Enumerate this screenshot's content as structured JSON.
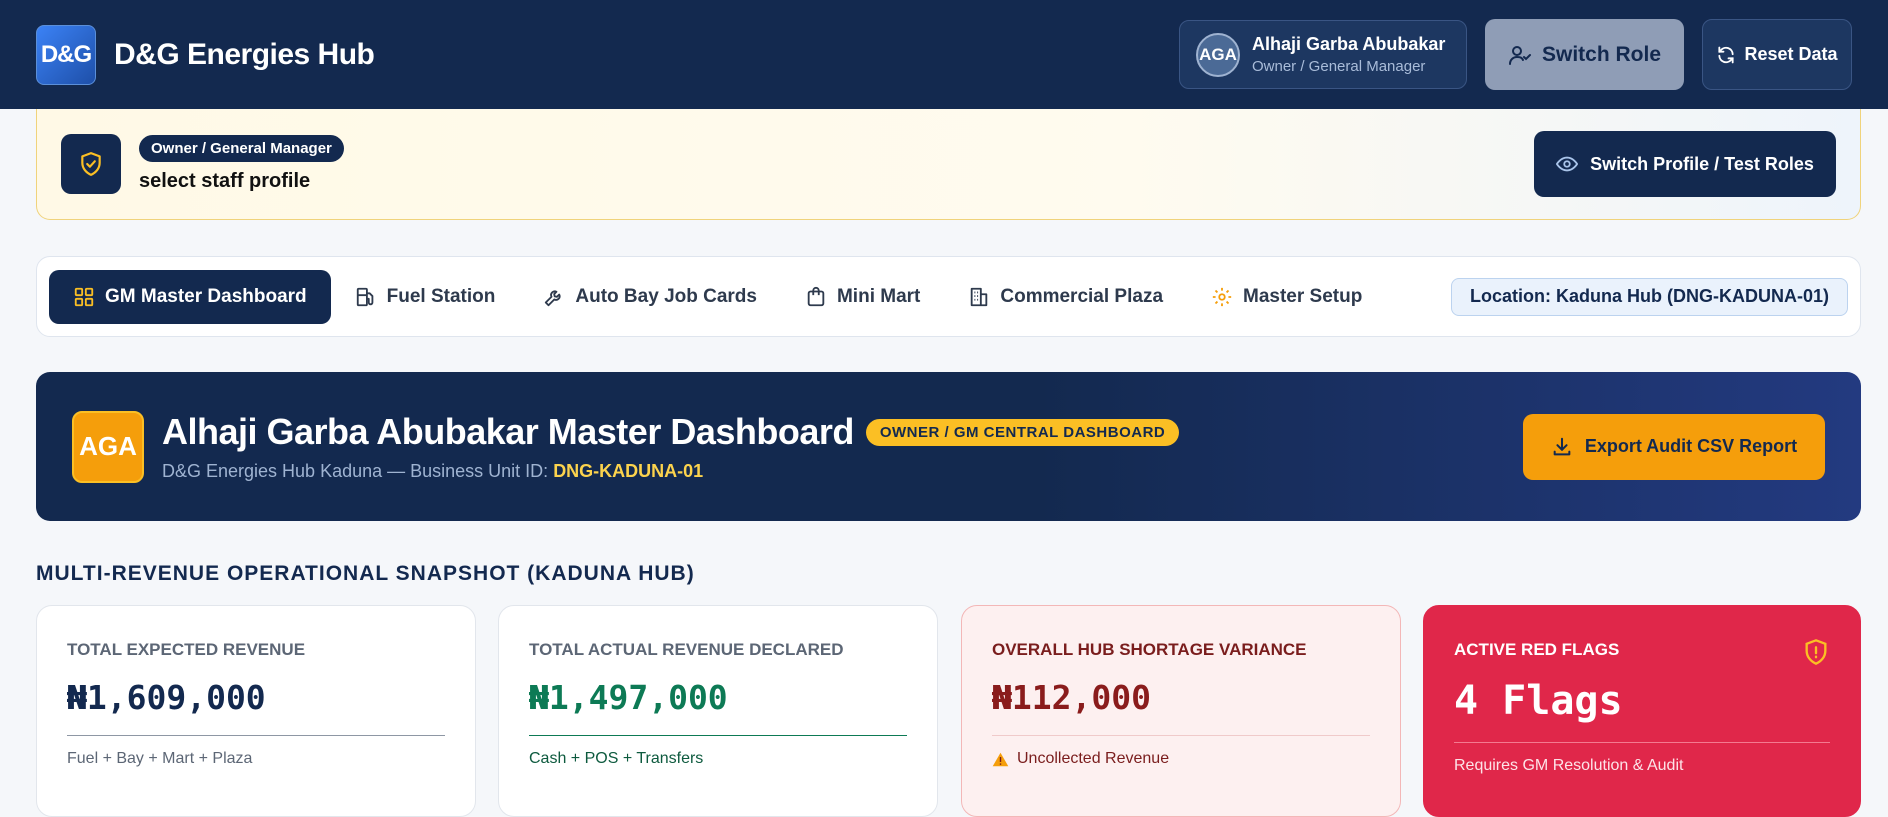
{
  "header": {
    "logo_text": "D&G",
    "app_title": "D&G Energies Hub",
    "user": {
      "initials": "AGA",
      "name": "Alhaji Garba Abubakar",
      "role": "Owner / General Manager"
    },
    "switch_role_label": "Switch Role",
    "reset_label": "Reset Data"
  },
  "role_banner": {
    "role_pill": "Owner / General Manager",
    "subtitle": "select staff profile",
    "profile_button": "Switch Profile / Test Roles"
  },
  "nav": {
    "tabs": [
      {
        "label": "GM Master Dashboard",
        "icon": "grid-icon",
        "active": true
      },
      {
        "label": "Fuel Station",
        "icon": "fuel-pump-icon"
      },
      {
        "label": "Auto Bay Job Cards",
        "icon": "wrench-icon"
      },
      {
        "label": "Mini Mart",
        "icon": "shopping-bag-icon"
      },
      {
        "label": "Commercial Plaza",
        "icon": "building-icon"
      },
      {
        "label": "Master Setup",
        "icon": "gear-icon"
      }
    ],
    "location": "Location: Kaduna Hub (DNG-KADUNA-01)"
  },
  "master": {
    "initials": "AGA",
    "title": "Alhaji Garba Abubakar Master Dashboard",
    "badge": "OWNER / GM CENTRAL DASHBOARD",
    "subtitle_prefix": "D&G Energies Hub Kaduna — Business Unit ID: ",
    "business_unit_id": "DNG-KADUNA-01",
    "export_button": "Export Audit CSV Report"
  },
  "snapshot": {
    "heading": "MULTI-REVENUE OPERATIONAL SNAPSHOT (KADUNA HUB)",
    "cards": [
      {
        "label": "TOTAL EXPECTED REVENUE",
        "value": "₦1,609,000",
        "foot": "Fuel + Bay + Mart + Plaza"
      },
      {
        "label": "TOTAL ACTUAL REVENUE DECLARED",
        "value": "₦1,497,000",
        "foot": "Cash + POS + Transfers"
      },
      {
        "label": "OVERALL HUB SHORTAGE VARIANCE",
        "value": "₦112,000",
        "foot": "Uncollected Revenue"
      },
      {
        "label": "ACTIVE RED FLAGS",
        "value": "4 Flags",
        "foot": "Requires GM Resolution & Audit"
      }
    ]
  },
  "colors": {
    "navy": "#13294f",
    "amber": "#f59e0b",
    "green": "#0d7a55",
    "red_flag": "#e0274a"
  }
}
